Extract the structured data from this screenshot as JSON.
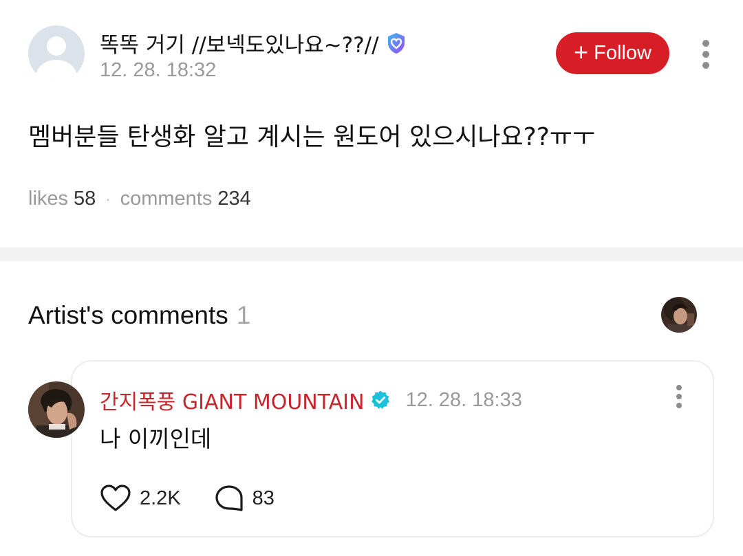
{
  "post": {
    "author_name": "똑똑 거기 //보넥도있나요~??//",
    "date": "12. 28. 18:32",
    "follow_label": "Follow",
    "body": "멤버분들 탄생화 알고 계시는 원도어 있으시나요??ㅠㅜ",
    "likes_label": "likes",
    "likes_count": "58",
    "comments_label": "comments",
    "comments_count": "234",
    "separator": "·"
  },
  "artist_comments": {
    "title": "Artist's comments",
    "count": "1",
    "items": [
      {
        "author": "간지폭풍 GIANT MOUNTAIN",
        "date": "12. 28. 18:33",
        "text": "나 이끼인데",
        "likes": "2.2K",
        "replies": "83"
      }
    ]
  },
  "colors": {
    "accent_red": "#d71e27",
    "artist_name": "#c7242c",
    "verified_teal": "#18c3d9",
    "badge_purple": "#7b5cf5"
  },
  "icons": {
    "avatar": "default-user-icon",
    "badge": "heart-shield-icon",
    "verified": "verified-check-icon",
    "like": "heart-outline-icon",
    "reply": "speech-bubble-icon",
    "more": "kebab-menu-icon"
  }
}
